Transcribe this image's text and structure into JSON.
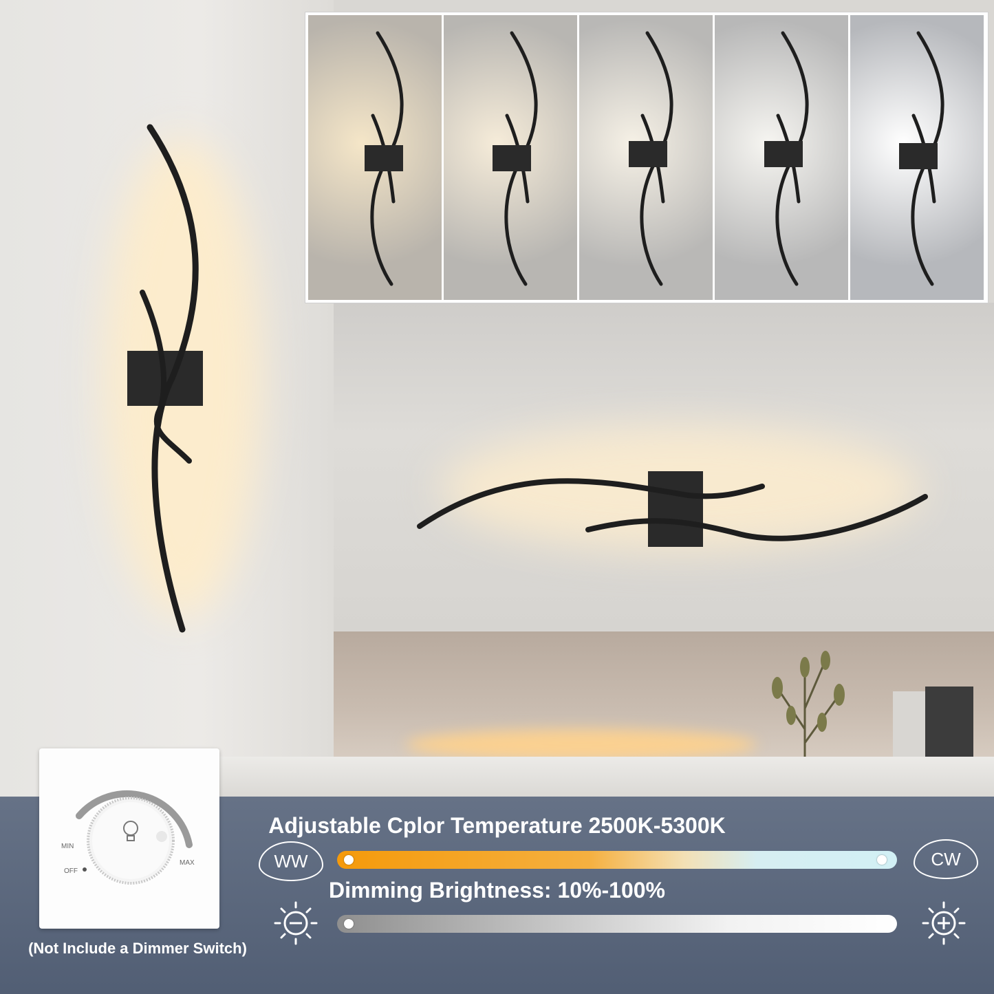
{
  "banner": {
    "color_temp_title": "Adjustable Cplor Temperature 2500K-5300K",
    "ww_label": "WW",
    "cw_label": "CW",
    "brightness_title": "Dimming Brightness: 10%-100%",
    "dimmer_note": "(Not Include a Dimmer Switch)"
  },
  "dimmer_switch": {
    "min_label": "MIN",
    "off_label": "OFF",
    "max_label": "MAX"
  },
  "swatches": [
    "#d9cbb4",
    "#dad0c1",
    "#dfdad2",
    "#e3e2df",
    "#eef0f2"
  ],
  "colors": {
    "warm": "#f5a623",
    "cool": "#ffffff",
    "banner": "#56647c"
  },
  "icons": [
    "brightness-down-icon",
    "brightness-up-icon",
    "bulb-icon"
  ]
}
